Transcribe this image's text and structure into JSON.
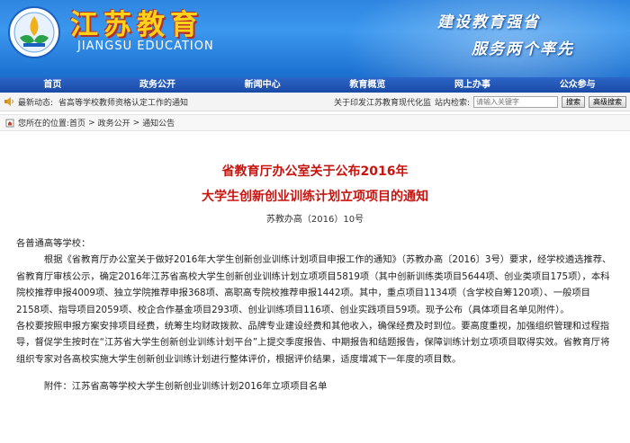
{
  "header": {
    "site_name_cn": "江苏教育",
    "site_name_en": "JIANGSU EDUCATION",
    "slogan_1": "建设教育强省",
    "slogan_2": "服务两个率先",
    "logo_icon": "jiangsu-education-emblem"
  },
  "nav": {
    "items": [
      {
        "label": "首页"
      },
      {
        "label": "政务公开"
      },
      {
        "label": "新闻中心"
      },
      {
        "label": "教育概览"
      },
      {
        "label": "网上办事"
      },
      {
        "label": "公众参与"
      }
    ]
  },
  "notice": {
    "label": "最新动态:",
    "ticker_text": "省高等学校教师资格认定工作的通知",
    "ticker_text_2": "关于印发江苏教育现代化监",
    "search_label": "站内检索:",
    "search_placeholder": "请输入关键字",
    "search_button": "搜索",
    "advanced_button": "高级搜索",
    "speaker_icon": "speaker-icon"
  },
  "breadcrumb": {
    "prefix": "您所在的位置:",
    "items": [
      "首页",
      "政务公开",
      "通知公告"
    ]
  },
  "article": {
    "title_line1": "省教育厅办公室关于公布2016年",
    "title_line2": "大学生创新创业训练计划立项项目的通知",
    "doc_number": "苏教办高（2016）10号",
    "salutation": "各普通高等学校：",
    "para1": "根据《省教育厅办公室关于做好2016年大学生创新创业训练计划项目申报工作的通知》（苏教办高〔2016〕3号）要求，经学校遴选推荐、省教育厅审核公示，确定2016年江苏省高校大学生创新创业训练计划立项项目5819项（其中创新训练类项目5644项、创业类项目175项），本科院校推荐申报4009项、独立学院推荐申报368项、高职高专院校推荐申报1442项。其中，重点项目1134项（含学校自筹120项）、一般项目2158项、指导项目2059项、校企合作基金项目293项、创业训练项目116项、创业实践项目59项。现予公布（具体项目名单见附件）。",
    "para2": "各校要按照申报方案安排项目经费，统筹生均财政拨款、品牌专业建设经费和其他收入，确保经费及时到位。要高度重视，加强组织管理和过程指导，督促学生按时在“江苏省大学生创新创业训练计划平台”上提交季度报告、中期报告和结题报告，保障训练计划立项项目取得实效。省教育厅将组织专家对各高校实施大学生创新创业训练计划进行整体评价，根据评价结果，适度增减下一年度的项目数。",
    "attachment": "附件：江苏省高等学校大学生创新创业训练计划2016年立项项目名单"
  },
  "colors": {
    "banner_blue": "#2f86e0",
    "nav_blue": "#1a4aa6",
    "title_red": "#c8140e",
    "site_name_yellow": "#ffd21a"
  }
}
